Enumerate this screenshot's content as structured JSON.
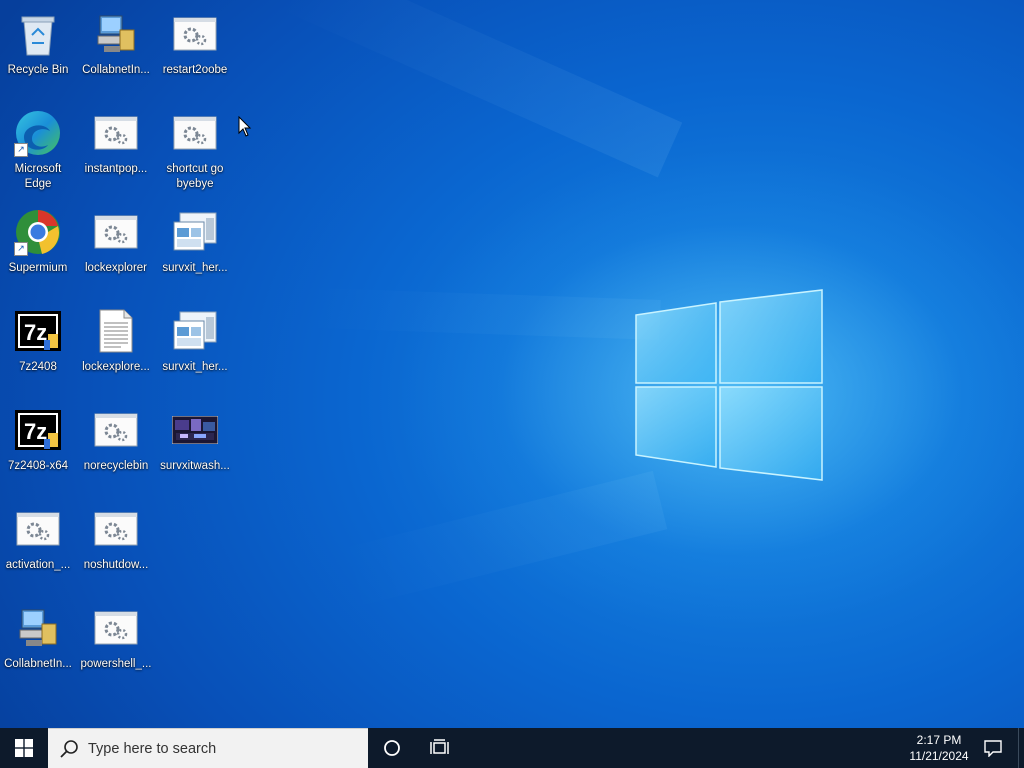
{
  "desktop": {
    "icons": [
      {
        "label": "Recycle Bin",
        "icon": "recycle-bin-icon"
      },
      {
        "label": "CollabnetIn...",
        "icon": "computer-setup-icon"
      },
      {
        "label": "restart2oobe",
        "icon": "batch-file-icon"
      },
      {
        "label": "Microsoft\nEdge",
        "icon": "edge-icon"
      },
      {
        "label": "instantpop...",
        "icon": "batch-file-icon"
      },
      {
        "label": "shortcut go\nbyebye",
        "icon": "batch-file-icon"
      },
      {
        "label": "Supermium",
        "icon": "supermium-icon"
      },
      {
        "label": "lockexplorer",
        "icon": "batch-file-icon"
      },
      {
        "label": "survxit_her...",
        "icon": "registry-file-icon"
      },
      {
        "label": "7z2408",
        "icon": "7zip-installer-icon"
      },
      {
        "label": "lockexplore...",
        "icon": "text-document-icon"
      },
      {
        "label": "survxit_her...",
        "icon": "registry-file-icon"
      },
      {
        "label": "7z2408-x64",
        "icon": "7zip-installer-icon"
      },
      {
        "label": "norecyclebin",
        "icon": "batch-file-icon"
      },
      {
        "label": "survxitwash...",
        "icon": "image-file-icon"
      },
      {
        "label": "activation_...",
        "icon": "batch-file-icon"
      },
      {
        "label": "noshutdow...",
        "icon": "batch-file-icon"
      },
      {
        "label": "CollabnetIn...",
        "icon": "computer-setup-icon"
      },
      {
        "label": "powershell_...",
        "icon": "batch-file-icon"
      }
    ]
  },
  "taskbar": {
    "start_icon": "windows-logo-icon",
    "search_placeholder": "Type here to search",
    "cortana_icon": "cortana-circle-icon",
    "taskview_icon": "task-view-icon",
    "clock_time": "2:17 PM",
    "clock_date": "11/21/2024",
    "notification_icon": "action-center-icon"
  },
  "colors": {
    "taskbar": "#0d1a2b",
    "search_box": "#f2f2f2",
    "desktop_blue": "#0a66d0",
    "logo_glow": "#7fdcff"
  }
}
